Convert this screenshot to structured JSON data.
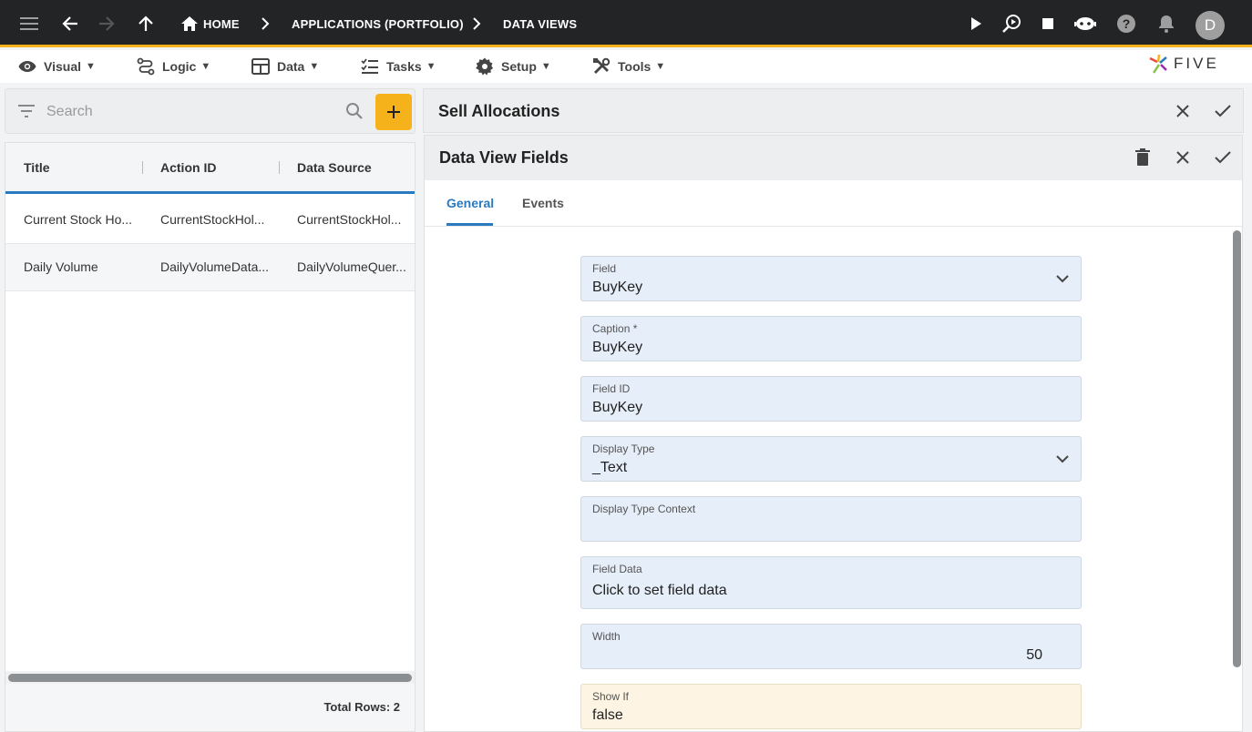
{
  "topbar": {
    "breadcrumbs": [
      "HOME",
      "APPLICATIONS (PORTFOLIO)",
      "DATA VIEWS"
    ],
    "avatar_initial": "D",
    "accent_color": "#f5b21b"
  },
  "menubar": {
    "items": [
      "Visual",
      "Logic",
      "Data",
      "Tasks",
      "Setup",
      "Tools"
    ],
    "caret": "▼"
  },
  "logo": {
    "text": "FIVE"
  },
  "search": {
    "placeholder": "Search",
    "add_label": "+"
  },
  "table": {
    "columns": [
      "Title",
      "Action ID",
      "Data Source"
    ],
    "rows": [
      [
        "Current Stock Ho...",
        "CurrentStockHol...",
        "CurrentStockHol..."
      ],
      [
        "Daily Volume",
        "DailyVolumeData...",
        "DailyVolumeQuer..."
      ]
    ],
    "total_rows": "Total Rows: 2"
  },
  "panel": {
    "title": "Sell Allocations",
    "subtitle": "Data View Fields",
    "tabs": [
      "General",
      "Events"
    ],
    "active_tab": "General"
  },
  "form": {
    "fields": [
      {
        "label": "Field",
        "value": "BuyKey",
        "type": "select"
      },
      {
        "label": "Caption *",
        "value": "BuyKey",
        "type": "text"
      },
      {
        "label": "Field ID",
        "value": "BuyKey",
        "type": "text"
      },
      {
        "label": "Display Type",
        "value": "_Text",
        "type": "select"
      },
      {
        "label": "Display Type Context",
        "value": "",
        "type": "text"
      },
      {
        "label": "Field Data",
        "value": "Click to set field data",
        "type": "button"
      },
      {
        "label": "Width",
        "value": "50",
        "type": "number"
      },
      {
        "label": "Show If",
        "value": "false",
        "type": "text"
      }
    ]
  }
}
